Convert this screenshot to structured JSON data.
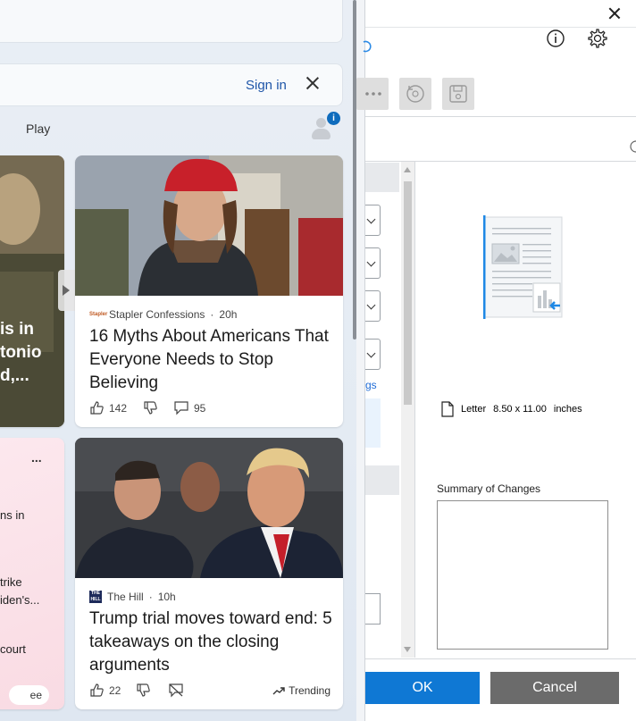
{
  "feed": {
    "signin_label": "Sign in",
    "tab_play": "Play",
    "notification_count": "i",
    "left_card1_lines": [
      "is in",
      "tonio",
      "d,..."
    ],
    "left_card2_lines": [
      "ns in",
      "trike",
      "iden's...",
      "court"
    ],
    "left_card2_menu": "...",
    "see_more": "ee more",
    "articles": [
      {
        "source": "Stapler Confessions",
        "age": "20h",
        "headline": "16 Myths About Americans That Everyone Needs to Stop Believing",
        "likes": "142",
        "comments": "95"
      },
      {
        "source": "The Hill",
        "age": "10h",
        "headline": "Trump trial moves toward end: 5 takeaways on the closing arguments",
        "likes": "22",
        "trending": "Trending"
      }
    ]
  },
  "dialog": {
    "pane_link": "gs",
    "paper_name": "Letter",
    "paper_size": "8.50 x 11.00",
    "paper_unit": "inches",
    "summary_label": "Summary of Changes",
    "ok_label": "OK",
    "cancel_label": "Cancel",
    "accent": "#0f78d4"
  }
}
